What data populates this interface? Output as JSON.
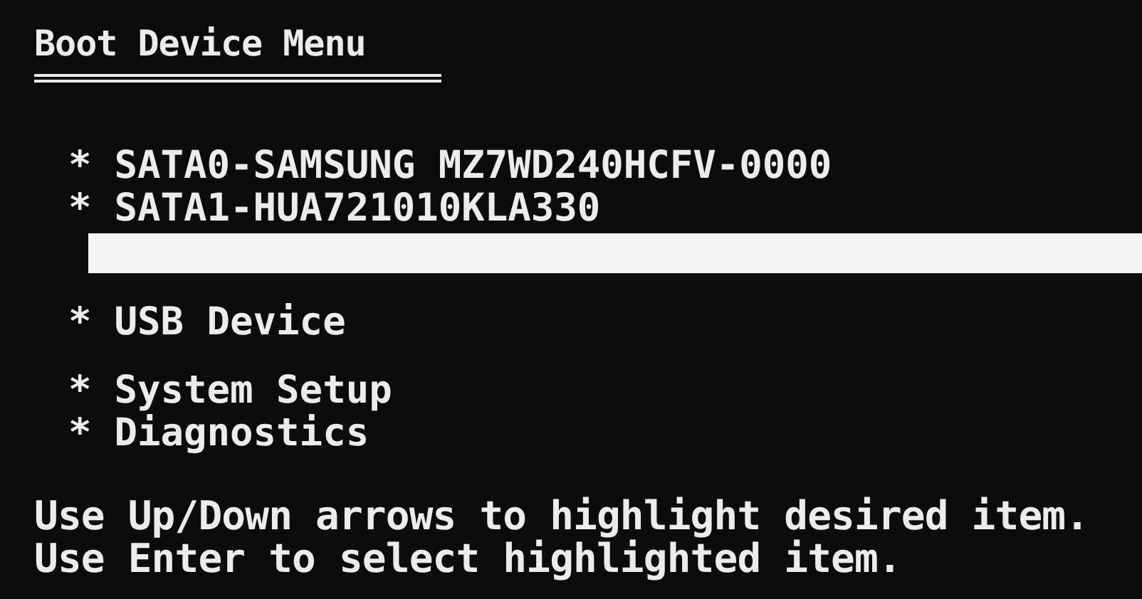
{
  "title": "Boot Device Menu",
  "groups": [
    {
      "items": [
        {
          "bullet": "*",
          "label": "SATA0-SAMSUNG MZ7WD240HCFV-0000",
          "selected": false
        },
        {
          "bullet": "*",
          "label": "SATA1-HUA721010KLA330",
          "selected": false
        },
        {
          "selected": true
        }
      ]
    },
    {
      "items": [
        {
          "bullet": "*",
          "label": "USB Device",
          "selected": false
        }
      ]
    },
    {
      "items": [
        {
          "bullet": "*",
          "label": "System Setup",
          "selected": false
        },
        {
          "bullet": "*",
          "label": "Diagnostics",
          "selected": false
        }
      ]
    }
  ],
  "instructions": [
    "Use Up/Down arrows to highlight desired item.",
    "Use Enter to select highlighted item."
  ]
}
